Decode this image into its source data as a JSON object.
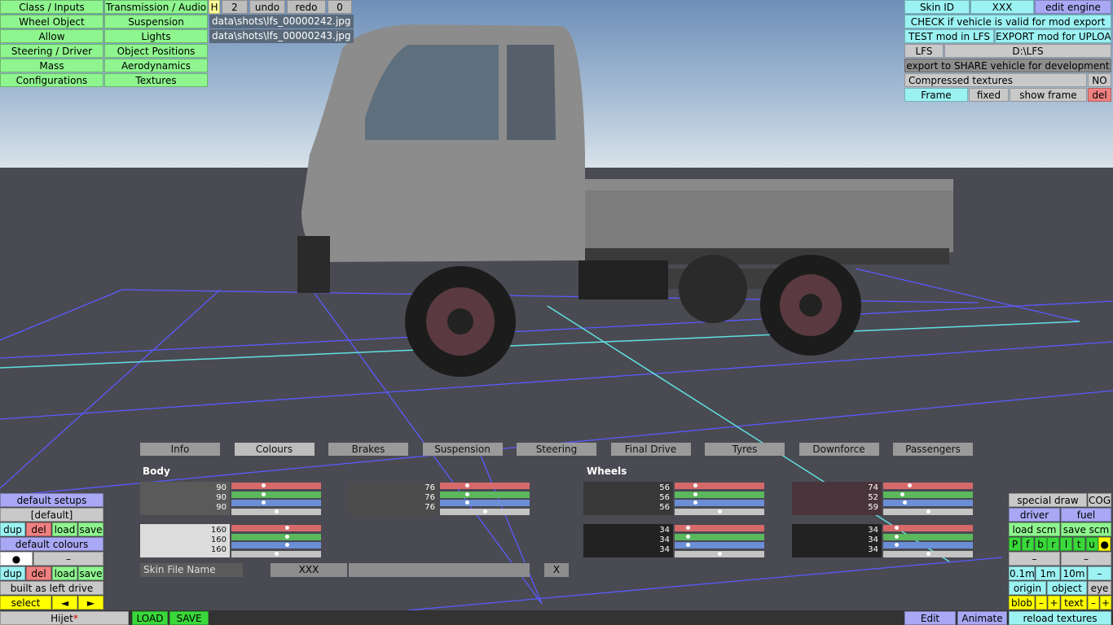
{
  "left_menu": [
    [
      "Class / Inputs",
      "Transmission / Audio"
    ],
    [
      "Wheel Object",
      "Suspension"
    ],
    [
      "Allow",
      "Lights"
    ],
    [
      "Steering / Driver",
      "Object Positions"
    ],
    [
      "Mass",
      "Aerodynamics"
    ],
    [
      "Configurations",
      "Textures"
    ]
  ],
  "top_bar": {
    "h": "H",
    "num": "2",
    "undo": "undo",
    "redo": "redo",
    "zero": "0"
  },
  "files": [
    "data\\shots\\lfs_00000242.jpg",
    "data\\shots\\lfs_00000243.jpg"
  ],
  "right_top": {
    "skin_id_label": "Skin ID",
    "skin_id_value": "XXX",
    "edit_engine": "edit engine",
    "check": "CHECK if vehicle is valid for mod export",
    "test": "TEST mod in LFS",
    "export": "EXPORT mod for UPLOAD",
    "lfs": "LFS",
    "path": "D:\\LFS",
    "share": "export to SHARE vehicle for development",
    "compressed": "Compressed textures",
    "compressed_value": "NO",
    "frame": "Frame",
    "fixed": "fixed",
    "show_frame": "show frame",
    "del": "del"
  },
  "tabs": [
    "Info",
    "Colours",
    "Brakes",
    "Suspension",
    "Steering",
    "Final Drive",
    "Tyres",
    "Downforce",
    "Passengers"
  ],
  "active_tab": "Colours",
  "colours": {
    "body_label": "Body",
    "wheels_label": "Wheels",
    "swatches": [
      {
        "id": "body1",
        "rgb": [
          90,
          90,
          90
        ],
        "hex": "#5a5a5a"
      },
      {
        "id": "body2",
        "rgb": [
          76,
          76,
          76
        ],
        "hex": "#4c4c4c"
      },
      {
        "id": "body3",
        "rgb": [
          160,
          160,
          160
        ],
        "hex": "#dcdcdc"
      },
      {
        "id": "wheel1",
        "rgb": [
          56,
          56,
          56
        ],
        "hex": "#383838"
      },
      {
        "id": "wheel2",
        "rgb": [
          74,
          52,
          59
        ],
        "hex": "#4a343b"
      },
      {
        "id": "wheel3",
        "rgb": [
          34,
          34,
          34
        ],
        "hex": "#222222"
      },
      {
        "id": "wheel4",
        "rgb": [
          34,
          34,
          34
        ],
        "hex": "#222222"
      }
    ],
    "skin_label": "Skin File Name",
    "skin_value": "XXX",
    "clear": "X"
  },
  "left_bottom": {
    "default_setups": "default setups",
    "default": "[default]",
    "dup": "dup",
    "del": "del",
    "load": "load",
    "save": "save",
    "default_colours": "default colours",
    "dot": "●",
    "dash": "–",
    "built": "built as left drive",
    "select": "select",
    "prev": "◄",
    "next": "►"
  },
  "status": {
    "car": "Hijet",
    "star": "*",
    "load": "LOAD",
    "save": "SAVE",
    "edit": "Edit",
    "animate": "Animate"
  },
  "right_bottom": {
    "special_draw": "special draw",
    "cog": "COG",
    "driver": "driver",
    "fuel": "fuel",
    "load_scm": "load scm",
    "save_scm": "save scm",
    "letters": [
      "P",
      "f",
      "b",
      "r",
      "l",
      "t",
      "u",
      "●"
    ],
    "dash": "–",
    "m01": "0.1m",
    "m1": "1m",
    "m10": "10m",
    "origin": "origin",
    "object": "object",
    "eye": "eye",
    "blob": "blob",
    "minus": "–",
    "plus": "+",
    "text": "text",
    "reload": "reload textures"
  }
}
